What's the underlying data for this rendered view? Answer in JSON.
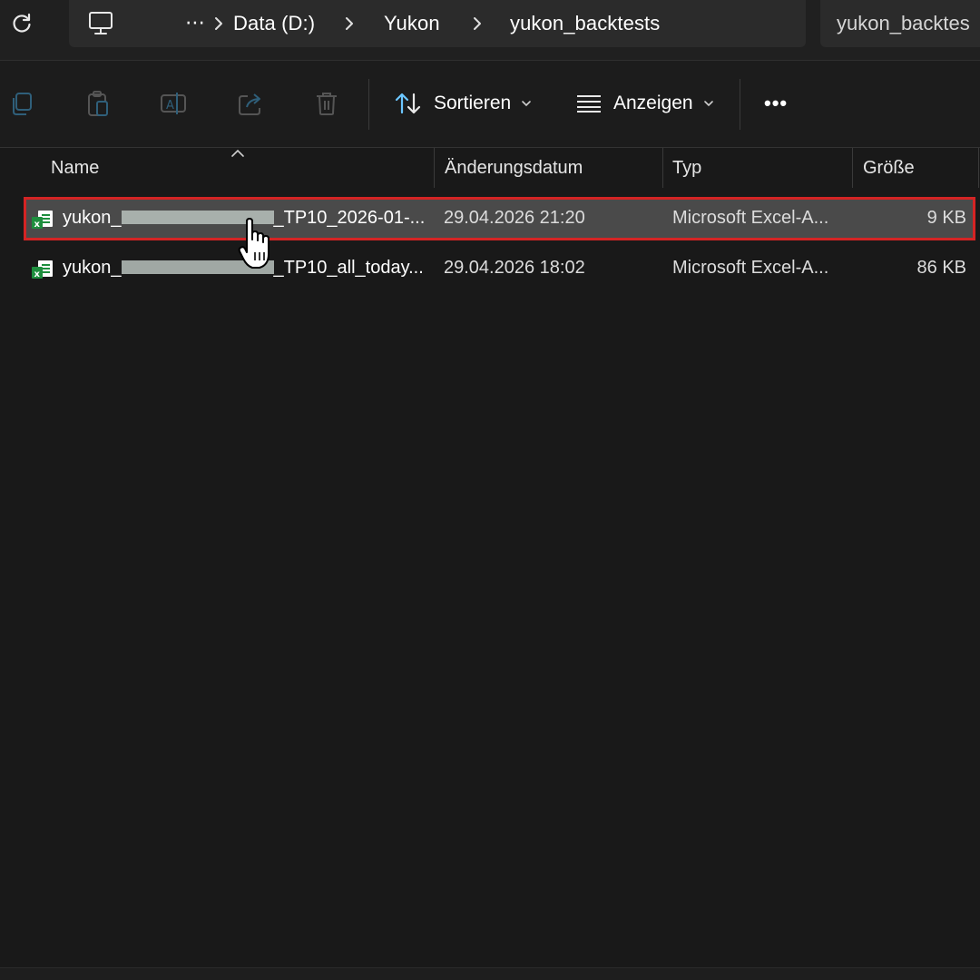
{
  "breadcrumb": {
    "pc_icon": "computer-icon",
    "more": "⋯",
    "items": [
      "Data (D:)",
      "Yukon",
      "yukon_backtests"
    ]
  },
  "search": {
    "text": "yukon_backtes"
  },
  "toolbar": {
    "icons": [
      "copy-icon",
      "paste-icon",
      "rename-icon",
      "share-icon",
      "delete-icon"
    ],
    "sort_label": "Sortieren",
    "view_label": "Anzeigen",
    "more_label": "•••"
  },
  "columns": {
    "name": "Name",
    "modified": "Änderungsdatum",
    "type": "Typ",
    "size": "Größe"
  },
  "files": [
    {
      "name_prefix": "yukon_",
      "name_suffix": "_TP10_2026-01-...",
      "modified": "29.04.2026 21:20",
      "type": "Microsoft Excel-A...",
      "size": "9 KB",
      "selected": true
    },
    {
      "name_prefix": "yukon_",
      "name_suffix": "_TP10_all_today...",
      "modified": "29.04.2026 18:02",
      "type": "Microsoft Excel-A...",
      "size": "86 KB",
      "selected": false
    }
  ],
  "colors": {
    "background": "#191919",
    "selection": "#4a4a4a",
    "highlight_border": "#d42424",
    "excel_green": "#1e8e3e"
  }
}
